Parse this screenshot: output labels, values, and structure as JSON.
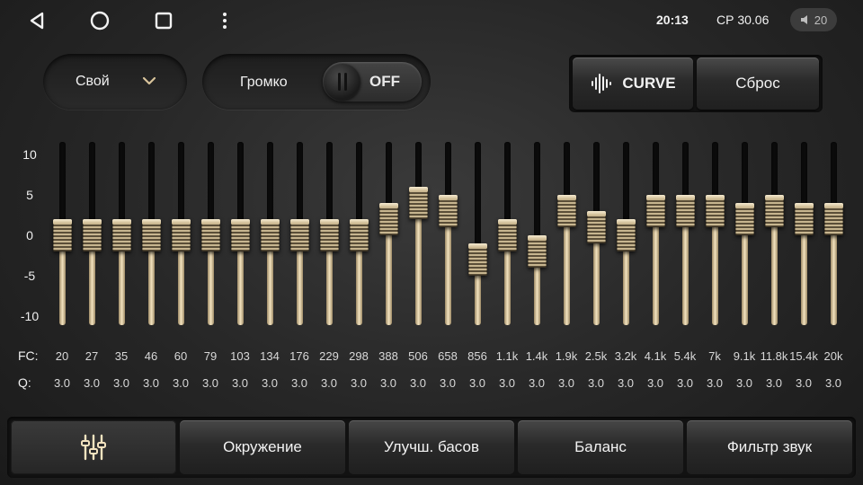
{
  "status_bar": {
    "time": "20:13",
    "date": "СР 30.06",
    "volume": "20",
    "icons": [
      "back-icon",
      "home-icon",
      "recents-icon",
      "more-icon",
      "volume-icon"
    ]
  },
  "preset": {
    "label": "Свой",
    "icon": "chevron-down-icon"
  },
  "loudness": {
    "label": "Громко",
    "state": "OFF"
  },
  "toolbar": {
    "curve_label": "CURVE",
    "curve_icon": "waveform-icon",
    "reset_label": "Сброс"
  },
  "eq": {
    "y_labels": [
      "10",
      "5",
      "0",
      "-5",
      "-10"
    ],
    "range": [
      -10,
      10
    ],
    "fc_label": "FC:",
    "q_label": "Q:",
    "bands": [
      {
        "fc": "20",
        "q": "3.0",
        "gain": 0
      },
      {
        "fc": "27",
        "q": "3.0",
        "gain": 0
      },
      {
        "fc": "35",
        "q": "3.0",
        "gain": 0
      },
      {
        "fc": "46",
        "q": "3.0",
        "gain": 0
      },
      {
        "fc": "60",
        "q": "3.0",
        "gain": 0
      },
      {
        "fc": "79",
        "q": "3.0",
        "gain": 0
      },
      {
        "fc": "103",
        "q": "3.0",
        "gain": 0
      },
      {
        "fc": "134",
        "q": "3.0",
        "gain": 0
      },
      {
        "fc": "176",
        "q": "3.0",
        "gain": 0
      },
      {
        "fc": "229",
        "q": "3.0",
        "gain": 0
      },
      {
        "fc": "298",
        "q": "3.0",
        "gain": 0
      },
      {
        "fc": "388",
        "q": "3.0",
        "gain": 2
      },
      {
        "fc": "506",
        "q": "3.0",
        "gain": 4
      },
      {
        "fc": "658",
        "q": "3.0",
        "gain": 3
      },
      {
        "fc": "856",
        "q": "3.0",
        "gain": -3
      },
      {
        "fc": "1.1k",
        "q": "3.0",
        "gain": 0
      },
      {
        "fc": "1.4k",
        "q": "3.0",
        "gain": -2
      },
      {
        "fc": "1.9k",
        "q": "3.0",
        "gain": 3
      },
      {
        "fc": "2.5k",
        "q": "3.0",
        "gain": 1
      },
      {
        "fc": "3.2k",
        "q": "3.0",
        "gain": 0
      },
      {
        "fc": "4.1k",
        "q": "3.0",
        "gain": 3
      },
      {
        "fc": "5.4k",
        "q": "3.0",
        "gain": 3
      },
      {
        "fc": "7k",
        "q": "3.0",
        "gain": 3
      },
      {
        "fc": "9.1k",
        "q": "3.0",
        "gain": 2
      },
      {
        "fc": "11.8k",
        "q": "3.0",
        "gain": 3
      },
      {
        "fc": "15.4k",
        "q": "3.0",
        "gain": 2
      },
      {
        "fc": "20k",
        "q": "3.0",
        "gain": 2
      }
    ]
  },
  "tabs": [
    {
      "label": "",
      "icon": "equalizer-sliders-icon",
      "active": true
    },
    {
      "label": "Окружение",
      "active": false
    },
    {
      "label": "Улучш. басов",
      "active": false
    },
    {
      "label": "Баланс",
      "active": false
    },
    {
      "label": "Фильтр звук",
      "active": false
    }
  ]
}
